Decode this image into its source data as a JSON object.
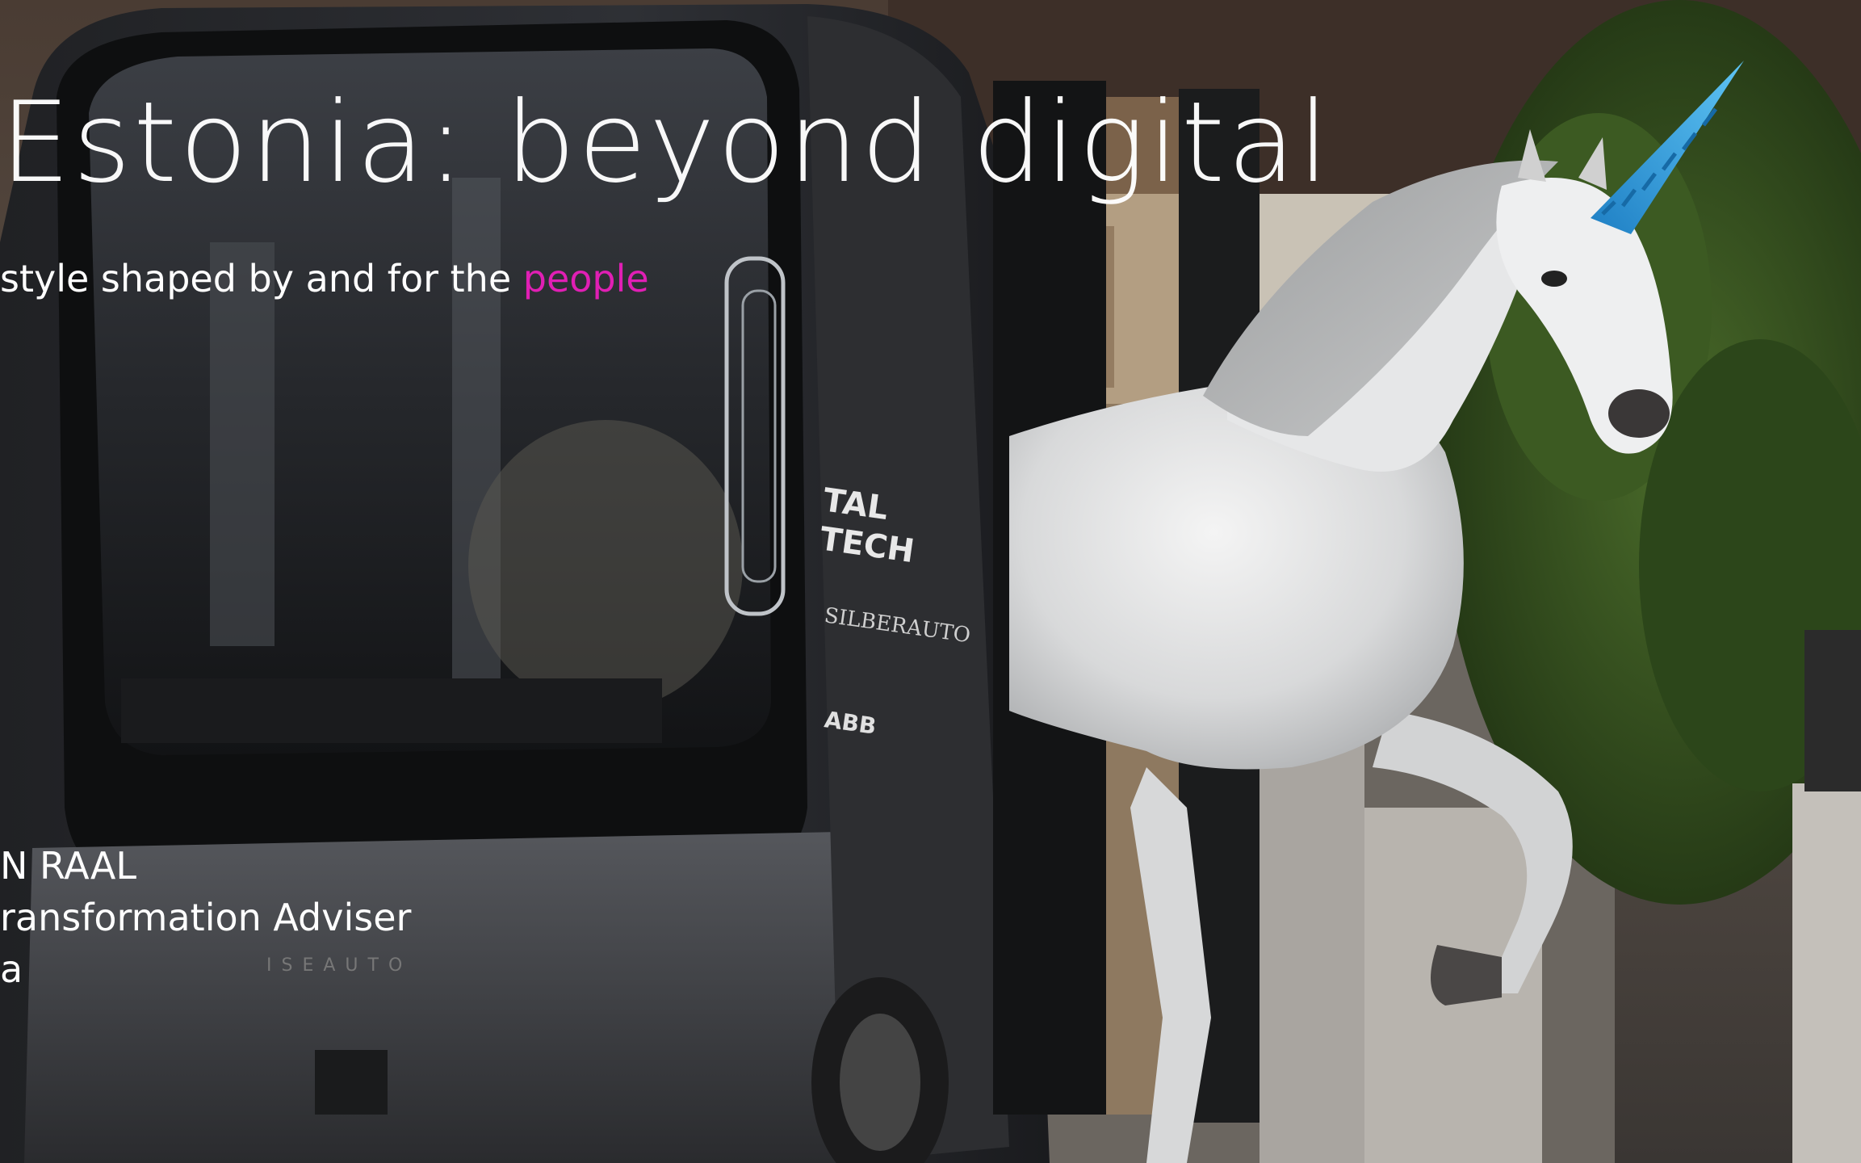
{
  "slide": {
    "title": "Estonia: beyond digital",
    "subtitle_prefix": "style shaped by and for the ",
    "subtitle_highlight": "people",
    "presenter_name": "N RAAL",
    "presenter_role": "ransformation Adviser",
    "presenter_org": "a"
  },
  "photo": {
    "vehicle_text": "ISEAUTO",
    "vehicle_logo_1": "TAL",
    "vehicle_logo_2": "TECH",
    "vehicle_brand": "SILBERAUTO",
    "vehicle_sponsor": "ABB"
  },
  "colors": {
    "accent": "#e01fb4",
    "text": "#ffffff",
    "horn": "#2aa6e8"
  }
}
